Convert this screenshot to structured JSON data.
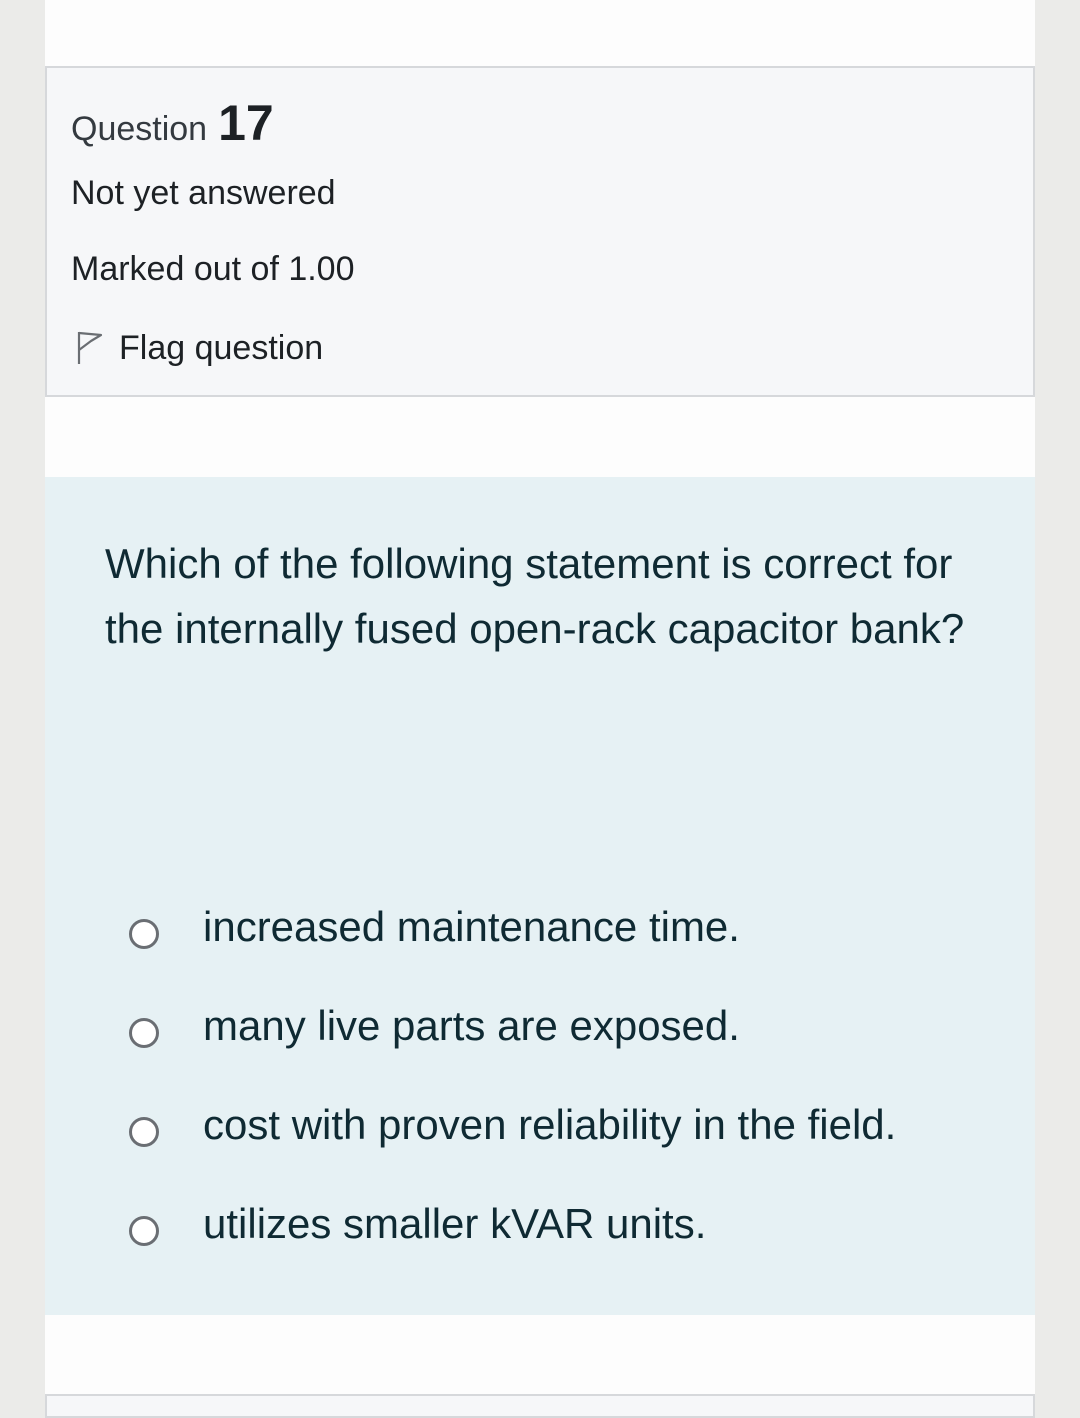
{
  "question_info": {
    "label": "Question",
    "number": "17",
    "state": "Not yet answered",
    "grade": "Marked out of 1.00",
    "flag_label": "Flag question",
    "flag_icon": "flag-outline-icon"
  },
  "question": {
    "text": "Which of the following statement is correct for the internally fused open-rack capacitor bank?",
    "options": [
      {
        "label": "increased maintenance time.",
        "selected": false
      },
      {
        "label": "many live parts are exposed.",
        "selected": false
      },
      {
        "label": "cost with proven reliability in the field.",
        "selected": false
      },
      {
        "label": "utilizes smaller kVAR units.",
        "selected": false
      }
    ]
  },
  "colors": {
    "page_background": "#ebebe9",
    "info_box_background": "#f6f7f9",
    "info_box_border": "#d6d8db",
    "formulation_background": "#e6f1f4",
    "text": "#1d2125"
  }
}
